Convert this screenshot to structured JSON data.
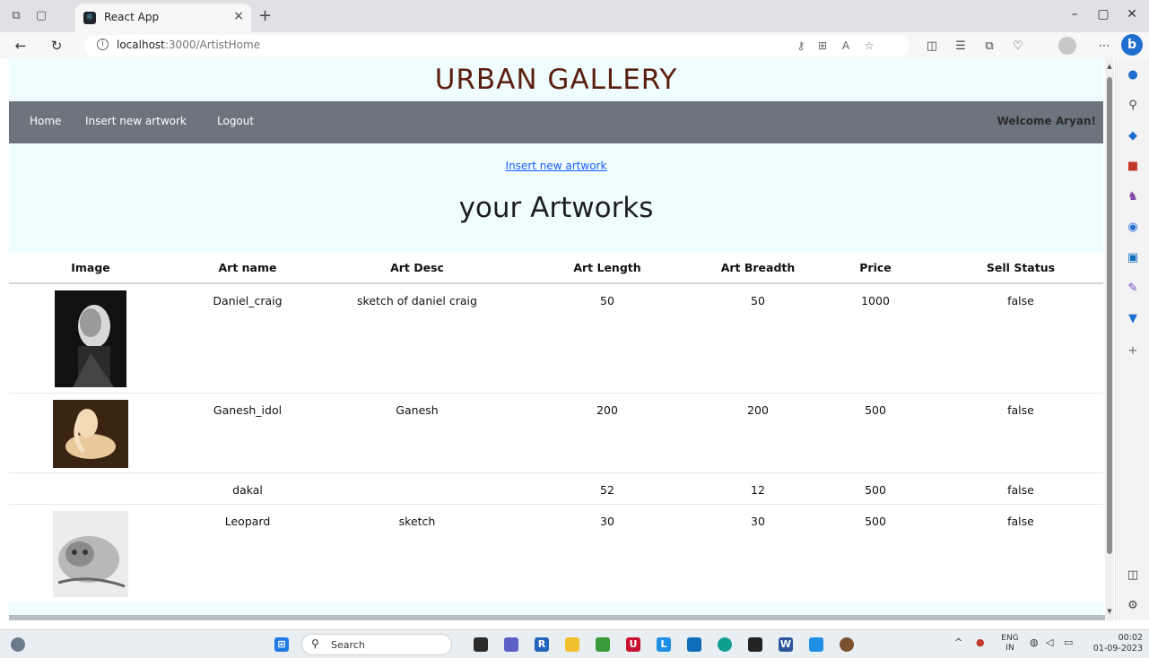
{
  "browser": {
    "tab_title": "React App",
    "url_host": "localhost",
    "url_rest": ":3000/ArtistHome",
    "tab_close": "×",
    "new_tab": "+"
  },
  "site": {
    "title": "URBAN GALLERY"
  },
  "nav": {
    "home": "Home",
    "insert": "Insert new artwork",
    "logout": "Logout",
    "welcome": "Welcome Aryan!"
  },
  "hero": {
    "insert_link": "Insert new artwork",
    "heading": "your Artworks"
  },
  "table": {
    "headers": [
      "Image",
      "Art name",
      "Art Desc",
      "Art Length",
      "Art Breadth",
      "Price",
      "Sell Status"
    ],
    "rows": [
      {
        "image": "daniel-craig-sketch",
        "name": "Daniel_craig",
        "desc": "sketch of daniel craig",
        "length": "50",
        "breadth": "50",
        "price": "1000",
        "status": "false"
      },
      {
        "image": "ganesh-idol-sculpture",
        "name": "Ganesh_idol",
        "desc": "Ganesh",
        "length": "200",
        "breadth": "200",
        "price": "500",
        "status": "false"
      },
      {
        "image": "",
        "name": "dakal",
        "desc": "",
        "length": "52",
        "breadth": "12",
        "price": "500",
        "status": "false"
      },
      {
        "image": "leopard-sketch",
        "name": "Leopard",
        "desc": "sketch",
        "length": "30",
        "breadth": "30",
        "price": "500",
        "status": "false"
      }
    ]
  },
  "taskbar": {
    "search": "Search",
    "lang_top": "ENG",
    "lang_bottom": "IN",
    "time": "00:02",
    "date": "01-09-2023"
  }
}
